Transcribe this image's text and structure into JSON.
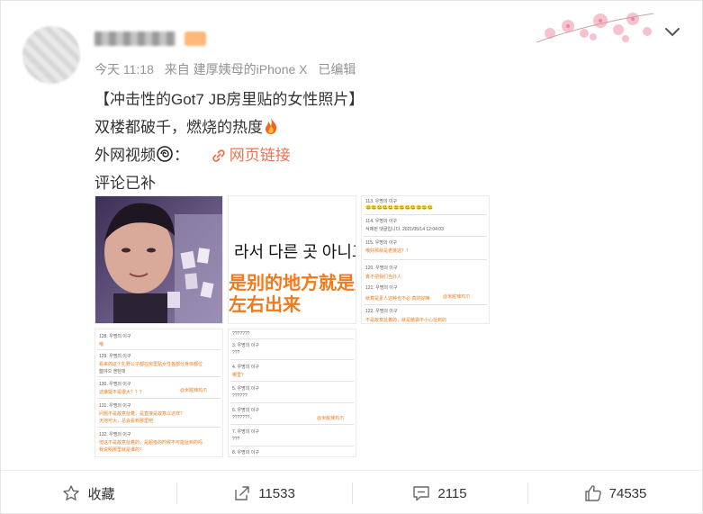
{
  "post": {
    "meta": {
      "time": "今天 11:18",
      "source": "来自 建厚姨母的iPhone X",
      "edited": "已编辑"
    },
    "content": {
      "line1": "【冲击性的Got7 JB房里贴的女性照片】",
      "line2": "双楼都破千，燃烧的热度",
      "line3_prefix": "外网视频",
      "line3_colon": "：",
      "web_link": "网页链接",
      "line4": "评论已补"
    },
    "images": {
      "caption_ko": "라서 다른 곳 아니고",
      "caption_zh_1": "是别的地方就是房",
      "caption_zh_2": "左右出来",
      "thumb3_rows": [
        "113. 우명의 이구",
        "114. 우명의 이구",
        "삭제된 댓글입니다.  2021/05/14 12:04:03",
        "115. 우명의 이구",
        "哦好那就是老婆这？？",
        "120. 우명의 이구",
        "真不把我们当外人",
        "121. 우명의 이구",
        "就算是素人这种也不必   真的好嘛",
        "122. 우명의 이구",
        "不是故意扯着的，就是脑袋不小心扯到的"
      ],
      "thumb3_tag": "@米脏辣鸡爪",
      "thumb4_rows": [
        "128. 우명의 이구",
        "哦",
        "129. 우명의 이구",
        "看来的这个扎野公子都在房里贴女性各部分身体都位",
        "蓝야으 엔탄데",
        "130. 우명의 이구",
        "这嫌疑不是很大？？？",
        "131. 우명의 이구",
        "问题不是故意扯着，是直接是故意以这样？",
        "天地可大，总会看到那里吧",
        "132. 우명의 이구",
        "但这不是故意扯着的，是超级的时候不可能扯到的吗",
        "我说明那里就是谁的？"
      ],
      "thumb4_tag": "@米脏辣鸡爪",
      "thumb5_rows": [
        "???????",
        "3. 우명의 이구",
        "???",
        "4. 우명의 이구",
        "哪里？",
        "5. 우명의 이구",
        "??????",
        "6. 우명의 이구",
        "???????..",
        "7. 우명의 이구",
        "???",
        "8. 우명의 이구"
      ],
      "thumb5_tag": "@米脏辣鸡爪"
    },
    "actions": {
      "favorite": "收藏",
      "repost_count": "11533",
      "comment_count": "2115",
      "like_count": "74535"
    }
  },
  "icons": {
    "link": "link-icon",
    "fire": "fire-icon",
    "spin_emoji": "dizzy-emoji-icon",
    "more": "chevron-down-icon",
    "favorite": "star-icon",
    "repost": "share-icon",
    "comment": "comment-icon",
    "like": "thumb-up-icon"
  },
  "colors": {
    "accent": "#eb7350",
    "meta_gray": "#939393",
    "text": "#333333"
  }
}
